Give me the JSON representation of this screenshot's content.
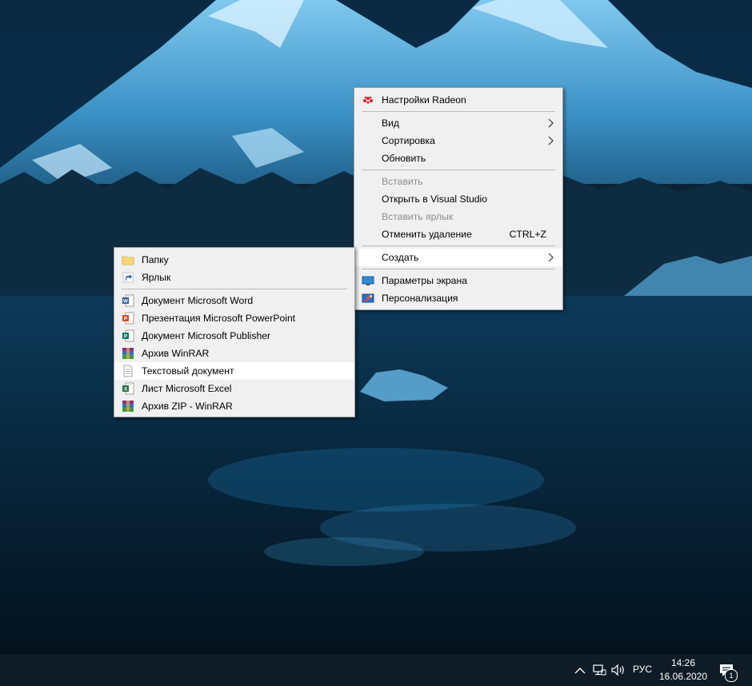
{
  "colors": {
    "menu_bg": "#f0f0f0",
    "menu_highlight": "#ffffff",
    "disabled_text": "#8d8d8d",
    "taskbar_bg": "#0f1c27",
    "radeon_red": "#e0202a",
    "word_blue": "#2b579a",
    "powerpoint_red": "#d24726",
    "publisher_teal": "#077568",
    "excel_green": "#217346",
    "folder_yellow": "#f8d775"
  },
  "context_menu": {
    "items": [
      {
        "label": "Настройки Radeon",
        "icon": "radeon-icon"
      },
      {
        "label": "Вид",
        "submenu": true
      },
      {
        "label": "Сортировка",
        "submenu": true
      },
      {
        "label": "Обновить"
      },
      {
        "label": "Вставить",
        "disabled": true
      },
      {
        "label": "Открыть в Visual Studio"
      },
      {
        "label": "Вставить ярлык",
        "disabled": true
      },
      {
        "label": "Отменить удаление",
        "shortcut": "CTRL+Z"
      },
      {
        "label": "Создать",
        "submenu": true,
        "highlighted": true
      },
      {
        "label": "Параметры экрана",
        "icon": "display-settings-icon"
      },
      {
        "label": "Персонализация",
        "icon": "personalization-icon"
      }
    ]
  },
  "create_submenu": {
    "items": [
      {
        "label": "Папку",
        "icon": "folder-icon"
      },
      {
        "label": "Ярлык",
        "icon": "shortcut-icon"
      },
      {
        "label": "Документ Microsoft Word",
        "icon": "word-icon"
      },
      {
        "label": "Презентация Microsoft PowerPoint",
        "icon": "powerpoint-icon"
      },
      {
        "label": "Документ Microsoft Publisher",
        "icon": "publisher-icon"
      },
      {
        "label": "Архив WinRAR",
        "icon": "winrar-icon"
      },
      {
        "label": "Текстовый документ",
        "icon": "text-document-icon",
        "highlighted": true
      },
      {
        "label": "Лист Microsoft Excel",
        "icon": "excel-icon"
      },
      {
        "label": "Архив ZIP - WinRAR",
        "icon": "winrar-zip-icon"
      }
    ]
  },
  "taskbar": {
    "language": "РУС",
    "time": "14:26",
    "date": "16.06.2020",
    "notification_count": "1",
    "tray_icons": [
      "chevron-up-icon",
      "network-icon",
      "volume-icon",
      "action-center-icon"
    ]
  }
}
